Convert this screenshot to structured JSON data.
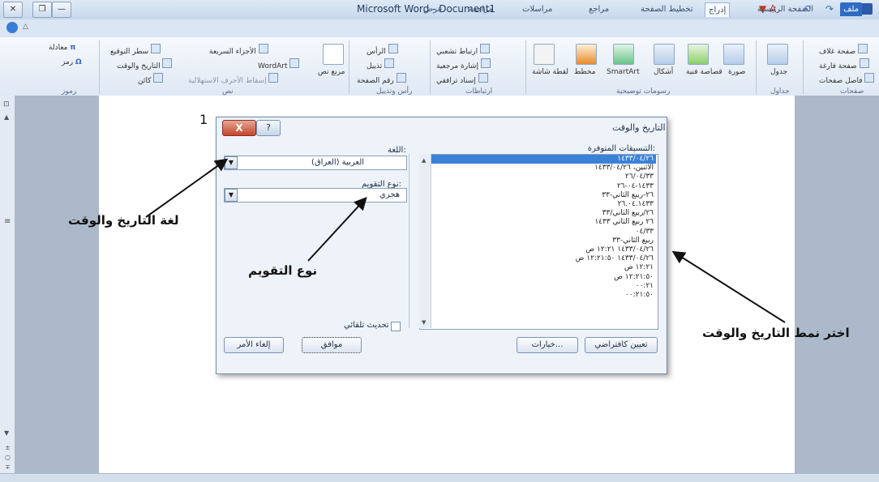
{
  "window": {
    "title": "Microsoft Word - Document1"
  },
  "tabs": [
    {
      "label": "ملف",
      "kind": "file"
    },
    {
      "label": "الصفحة الرئيسية",
      "kind": "normal"
    },
    {
      "label": "إدراج",
      "kind": "active"
    },
    {
      "label": "تخطيط الصفحة",
      "kind": "normal"
    },
    {
      "label": "مراجع",
      "kind": "normal"
    },
    {
      "label": "مراسلات",
      "kind": "normal"
    },
    {
      "label": "مراجعة",
      "kind": "normal"
    },
    {
      "label": "عرض",
      "kind": "normal"
    }
  ],
  "ribbon": {
    "groups": {
      "pages": "صفحات",
      "tables": "جداول",
      "illustrations": "رسومات توضيحية",
      "links": "ارتباطات",
      "header_footer": "رأس وتذييل",
      "text": "نص",
      "symbols": "رموز"
    },
    "pages_items": [
      "صفحة غلاف",
      "صفحة فارغة",
      "فاصل صفحات"
    ],
    "table_label": "جدول",
    "illustration_items": [
      "صورة",
      "قصاصة فنية",
      "أشكال",
      "SmartArt",
      "مخطط",
      "لقطة شاشة"
    ],
    "link_items": [
      "ارتباط تشعبي",
      "إشارة مرجعية",
      "إسناد ترافقي"
    ],
    "header_items": [
      "الرأس",
      "تذييل",
      "رقم الصفحة"
    ],
    "text_items": [
      "الأجزاء السريعة",
      "WordArt",
      "إسقاط الأحرف الاستهلالية",
      "سطر التوقيع",
      "التاريخ والوقت",
      "كائن"
    ],
    "textbox_label": "مربع نص",
    "symbol_items": [
      "معادلة",
      "رمز"
    ]
  },
  "dialog": {
    "title": "التاريخ والوقت",
    "close_glyph": "X",
    "help_glyph": "?",
    "formats_label": "التنسيقات المتوفرة:",
    "formats": [
      "١٤٣٣/٠٤/٢٦",
      "الاثنين، ١٤٣٣/٠٤/٢٦",
      "٢٦/٠٤/٣٣",
      "١٤٣٣-٠٤-٢٦",
      "٢٦-ربيع الثاني-٣٣",
      "٢٦.٠٤.١٤٣٣",
      "٢٦/ربيع الثاني/٣٣",
      "٢٦ ربيع الثاني ١٤٣٣",
      "٠٤/٣٣",
      "ربيع الثاني-٣٣",
      "١٤٣٣/٠٤/٢٦ ١٢:٢١ ص",
      "١٤٣٣/٠٤/٢٦ ١٢:٢١:٥٠ ص",
      "١٢:٢١ ص",
      "١٢:٢١:٥٠ ص",
      "٠٠:٢١",
      "٠٠:٢١:٥٠"
    ],
    "language_label": "اللغة:",
    "language_value": "العربية (العراق)",
    "calendar_label": "نوع التقويم:",
    "calendar_value": "هجري",
    "auto_update_label": "تحديث تلقائي",
    "set_default_label": "تعيين كافتراضي",
    "options_label": "خيارات...",
    "ok_label": "موافق",
    "cancel_label": "إلغاء الأمر",
    "dropdown_glyph": "▼"
  },
  "annotations": {
    "number": "1",
    "language_callout": "لغة التاريخ والوقت",
    "calendar_callout": "نوع التقويم",
    "format_callout": "اختر نمط التاريخ والوقت"
  }
}
